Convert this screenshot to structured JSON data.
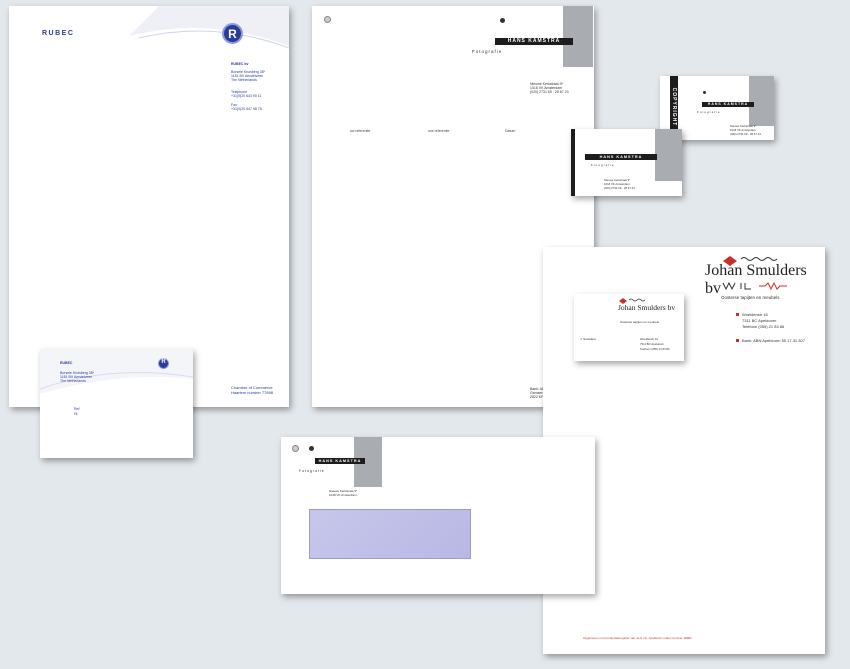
{
  "rubec": {
    "brand": "RUBEC",
    "logo_letter": "R",
    "company": "RUBEC bv",
    "address": [
      "Borsele Kruisberg 38*",
      "1181 BV Amstelveen",
      "The Netherlands"
    ],
    "telephone_label": "Telephone",
    "telephone": "+31(0)20 643 90 11",
    "fax_label": "Fax",
    "fax": "+31(0)20 647 98 78",
    "chamber": "Chamber of Commerce",
    "chamber_number": "Haarlem number 77898",
    "card_address": [
      "Borsele Kruisberg 38*",
      "1181 BV Amstelveen",
      "The Netherlands"
    ],
    "card_ref": [
      "Ref.",
      "Hl."
    ]
  },
  "kamstra": {
    "bar_text": "HANS KAMSTRA",
    "subtitle": "Fotografie",
    "address": [
      "Nieuwe Kerkstraat 9*",
      "1018 VK Amsterdam",
      "(020) 2731 69 · 28 67 23"
    ],
    "letter_fields": [
      "uw referentie",
      "ons referentie",
      "Datum"
    ],
    "footer": [
      "Bank: ABN 49.75.70.853",
      "Gemeentebank: uit de koerle",
      "2822 KF98 Roetingstraat"
    ],
    "card_copyright": "COPYRIGHT",
    "envelope_address": [
      "Nieuwe Kerkstraat 9*",
      "1018 VK Amsterdam"
    ]
  },
  "smulders": {
    "name": "Johan Smulders bv",
    "tagline": "Oosterse tapijten en meubels",
    "address": [
      "Woeldenstr 16",
      "7311 BC Apeldoorn",
      "Telefoon (055) 21 83 86"
    ],
    "bank": "Bank: ABN Apeldoorn 55.17.31.307",
    "card_person": "J. Smulders",
    "card_address": [
      "Woeldenstr 16",
      "7311 BC Apeldoorn",
      "Telefoon (055) 21 83 86"
    ],
    "footer": "Opgenomen in het Handelsregister van de K.v.K. Apeldoorn onder nummer 48991"
  }
}
